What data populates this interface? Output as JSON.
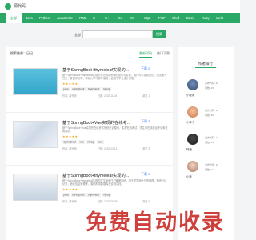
{
  "header": {
    "site_name": "源代码"
  },
  "nav": {
    "items": [
      "全部",
      "Java",
      "Python",
      "JavaScript",
      "HTML",
      "C",
      "C++",
      "Go",
      "C#",
      "SQL",
      "PHP",
      "Shell",
      "Basic",
      "Ruby",
      "Swift"
    ]
  },
  "search": {
    "label": "全部",
    "placeholder": "",
    "button": "搜索"
  },
  "list": {
    "left_label": "搜索结果：日记",
    "tabs": [
      "最新代码",
      "热门下载"
    ]
  },
  "articles": [
    {
      "title": "基于SpringBoot+thymeleaf实现的...",
      "badge": "下载 0",
      "desc": "基于SpringBoot+thymeleaf实现的日记网站系统的设计与实现，用户可以发表日记，浏览他人日记，发表评论等，本站为学习参考使用，适用于毕业设计开发。",
      "stars": "★★★★★",
      "tags": [
        "java",
        "springboot",
        "thymeleaf",
        "mysql"
      ],
      "meta_author": "作者: 源代码",
      "meta_date": "日期: 2022-11-04",
      "meta_views": "浏览 1"
    },
    {
      "title": "基于SpringBoot+Vue实现的在线考...",
      "badge": "下载 3",
      "desc": "基于SpringBoot+Vue实现的在线考试系统日记模块，实现在线考试，学生可在线参加考试和查看成绩。",
      "stars": "★★★★★",
      "tags": [
        "springboot",
        "vue",
        "mysql",
        "java"
      ],
      "meta_author": "作者: 源代码",
      "meta_date": "日期: 2022-10-12",
      "meta_views": "浏览 3"
    },
    {
      "title": "基于SpringBoot+thymeleaf实现的...",
      "badge": "下载 0",
      "desc": "基于SpringBoot+thymeleaf实现的学生宿舍日记管理系统，用于学生宿舍日常管理，宿舍日记记录，宿舍信息管理等，源码附带数据库及说明文档。",
      "stars": "★★★★★",
      "tags": [
        "java",
        "springboot",
        "thymeleaf",
        "mysql"
      ],
      "meta_author": "作者: 源代码",
      "meta_date": "日期: 2022-09-28",
      "meta_views": "浏览 0"
    }
  ],
  "ranking": {
    "title": "作者排行",
    "items": [
      {
        "code_label": "发布代码: 20",
        "praise_label": "赞数: 45",
        "name": "小程序"
      },
      {
        "code_label": "发布代码: 18",
        "praise_label": "赞数: 36",
        "name": "小林子"
      },
      {
        "code_label": "发布代码: 13",
        "praise_label": "赞数: 29",
        "name": "阿狸"
      },
      {
        "code_label": "发布代码: 11",
        "praise_label": "赞数: 21",
        "name": "小美"
      }
    ]
  },
  "watermark": "免费自动收录",
  "colors": {
    "accent": "#2aa866",
    "watermark": "#c9302c",
    "link": "#3b82f6"
  }
}
